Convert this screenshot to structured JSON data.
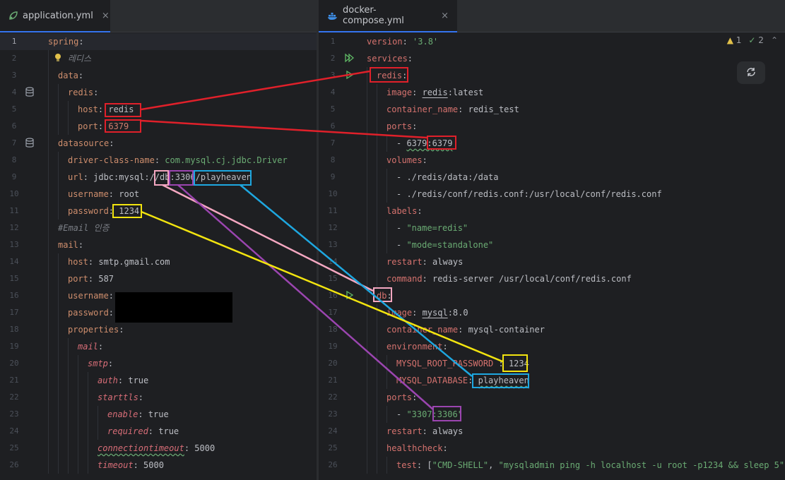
{
  "left": {
    "tab": {
      "label": "application.yml",
      "close": "×"
    },
    "lines": [
      {
        "n": "1",
        "html": "<span class='k'>spring</span><span class='v'>:</span>"
      },
      {
        "n": "2",
        "html": "<span class='c'>레디스</span>"
      },
      {
        "n": "3",
        "html": "<span class='k'>data</span><span class='v'>:</span>"
      },
      {
        "n": "4",
        "html": "<span class='k'>redis</span><span class='v'>:</span>"
      },
      {
        "n": "5",
        "html": "<span class='k'>host</span><span class='v'>: redis</span>"
      },
      {
        "n": "6",
        "html": "<span class='k'>port</span><span class='v'>: </span><span class='ky'>6379</span>"
      },
      {
        "n": "7",
        "html": "<span class='k'>datasource</span><span class='v'>:</span>"
      },
      {
        "n": "8",
        "html": "<span class='k'>driver-class-name</span><span class='v'>: </span><span class='s'>com.mysql.cj.jdbc.Driver</span>"
      },
      {
        "n": "9",
        "html": "<span class='k'>url</span><span class='v'>: jdbc:mysql://db:3306/playheaven</span>"
      },
      {
        "n": "10",
        "html": "<span class='k'>username</span><span class='v'>: root</span>"
      },
      {
        "n": "11",
        "html": "<span class='k'>password</span><span class='v'>: 1234</span>"
      },
      {
        "n": "12",
        "html": "<span class='c'>#Email 인증</span>"
      },
      {
        "n": "13",
        "html": "<span class='k'>mail</span><span class='v'>:</span>"
      },
      {
        "n": "14",
        "html": "<span class='k'>host</span><span class='v'>: smtp.gmail.com</span>"
      },
      {
        "n": "15",
        "html": "<span class='k'>port</span><span class='v'>: 587</span>"
      },
      {
        "n": "16",
        "html": "<span class='k'>username</span><span class='v'>:</span>"
      },
      {
        "n": "17",
        "html": "<span class='k'>password</span><span class='v'>:</span>"
      },
      {
        "n": "18",
        "html": "<span class='k'>properties</span><span class='v'>:</span>"
      },
      {
        "n": "19",
        "html": "<span class='kit'>mail</span><span class='v'>:</span>"
      },
      {
        "n": "20",
        "html": "<span class='kit'>smtp</span><span class='v'>:</span>"
      },
      {
        "n": "21",
        "html": "<span class='kit'>auth</span><span class='v'>: true</span>"
      },
      {
        "n": "22",
        "html": "<span class='kit'>starttls</span><span class='v'>:</span>"
      },
      {
        "n": "23",
        "html": "<span class='kit'>enable</span><span class='v'>: true</span>"
      },
      {
        "n": "24",
        "html": "<span class='kit'>required</span><span class='v'>: true</span>"
      },
      {
        "n": "25",
        "html": "<span class='kit squiggle'>connectiontimeout</span><span class='v'>: 5000</span>"
      },
      {
        "n": "26",
        "html": "<span class='kit'>timeout</span><span class='v'>: 5000</span>"
      }
    ]
  },
  "right": {
    "tab": {
      "label": "docker-compose.yml",
      "close": "×"
    },
    "inspections": {
      "warnings": "1",
      "ok": "2"
    },
    "lines": [
      {
        "n": "1",
        "html": "<span class='key'>version</span><span class='v'>: </span><span class='s'>'3.8'</span>"
      },
      {
        "n": "2",
        "html": "<span class='key'>services</span><span class='v'>:</span>"
      },
      {
        "n": "3",
        "html": "<span class='key'>redis</span><span class='v'>:</span>"
      },
      {
        "n": "4",
        "html": "<span class='key'>image</span><span class='v'>: </span><span class='v uline'>redis</span><span class='v'>:latest</span>"
      },
      {
        "n": "5",
        "html": "<span class='key'>container_name</span><span class='v'>: redis_test</span>"
      },
      {
        "n": "6",
        "html": "<span class='key'>ports</span><span class='v'>:</span>"
      },
      {
        "n": "7",
        "html": "<span class='v'>- </span><span class='v squiggle'>6379:6379</span>"
      },
      {
        "n": "8",
        "html": "<span class='key'>volumes</span><span class='v'>:</span>"
      },
      {
        "n": "9",
        "html": "<span class='v'>- ./redis/data:/data</span>"
      },
      {
        "n": "10",
        "html": "<span class='v'>- ./redis/conf/redis.conf:/usr/local/conf/redis.conf</span>"
      },
      {
        "n": "11",
        "html": "<span class='key'>labels</span><span class='v'>:</span>"
      },
      {
        "n": "12",
        "html": "<span class='v'>- </span><span class='s'>\"name=redis\"</span>"
      },
      {
        "n": "13",
        "html": "<span class='v'>- </span><span class='s'>\"mode=standalone\"</span>"
      },
      {
        "n": "14",
        "html": "<span class='key'>restart</span><span class='v'>: always</span>"
      },
      {
        "n": "15",
        "html": "<span class='key'>command</span><span class='v'>: redis-server /usr/local/conf/redis.conf</span>"
      },
      {
        "n": "16",
        "html": "<span class='key'>db</span><span class='v'>:</span>"
      },
      {
        "n": "17",
        "html": "<span class='key'>image</span><span class='v'>: </span><span class='v uline'>mysql</span><span class='v'>:8.0</span>"
      },
      {
        "n": "18",
        "html": "<span class='key'>container_name</span><span class='v'>: mysql-container</span>"
      },
      {
        "n": "19",
        "html": "<span class='key'>environment</span><span class='v'>:</span>"
      },
      {
        "n": "20",
        "html": "<span class='key'>MYSQL_ROOT_PASSWORD</span><span class='v'> : 1234</span>"
      },
      {
        "n": "21",
        "html": "<span class='key'>MYSQL_DATABASE</span><span class='v'>: </span><span class='v squiggle'>playheaven</span>"
      },
      {
        "n": "22",
        "html": "<span class='key'>ports</span><span class='v'>:</span>"
      },
      {
        "n": "23",
        "html": "<span class='v'>- </span><span class='s'>\"3307:3306\"</span>"
      },
      {
        "n": "24",
        "html": "<span class='key'>restart</span><span class='v'>: always</span>"
      },
      {
        "n": "25",
        "html": "<span class='key'>healthcheck</span><span class='v'>:</span>"
      },
      {
        "n": "26",
        "html": "<span class='key'>test</span><span class='v'>: [</span><span class='s'>\"CMD-SHELL\"</span><span class='v'>, </span><span class='s'>\"mysqladmin ping -h localhost -u root -p1234 &amp;&amp; sleep 5\"</span><span class='v'>]</span>"
      }
    ]
  },
  "colors": {
    "red": "#e0202a",
    "yellow": "#f2e40f",
    "pink": "#f4a7c1",
    "blue": "#1ea7e0",
    "purple": "#9b45b0"
  }
}
